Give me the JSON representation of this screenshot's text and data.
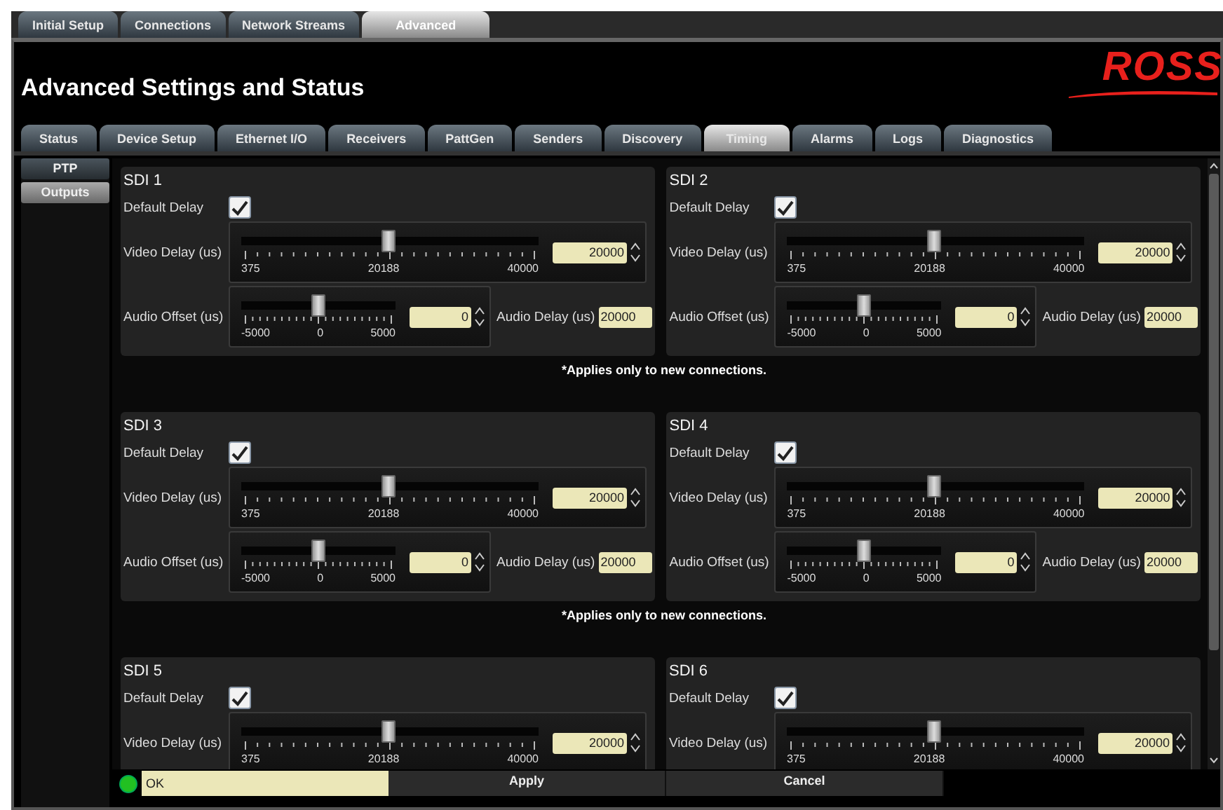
{
  "top_tabs": [
    {
      "label": "Initial Setup",
      "selected": false
    },
    {
      "label": "Connections",
      "selected": false
    },
    {
      "label": "Network Streams",
      "selected": false
    },
    {
      "label": "Advanced",
      "selected": true
    }
  ],
  "header": {
    "title": "Advanced Settings and Status",
    "logo": "ROSS"
  },
  "sub_tabs": [
    {
      "label": "Status",
      "selected": false
    },
    {
      "label": "Device Setup",
      "selected": false
    },
    {
      "label": "Ethernet I/O",
      "selected": false
    },
    {
      "label": "Receivers",
      "selected": false
    },
    {
      "label": "PattGen",
      "selected": false
    },
    {
      "label": "Senders",
      "selected": false
    },
    {
      "label": "Discovery",
      "selected": false
    },
    {
      "label": "Timing",
      "selected": true
    },
    {
      "label": "Alarms",
      "selected": false
    },
    {
      "label": "Logs",
      "selected": false
    },
    {
      "label": "Diagnostics",
      "selected": false
    }
  ],
  "side_menu": [
    {
      "label": "PTP",
      "selected": false
    },
    {
      "label": "Outputs",
      "selected": true
    }
  ],
  "groups": [
    {
      "channels": [
        {
          "name": "SDI 1",
          "default_delay": {
            "label": "Default Delay",
            "checked": true
          },
          "video_delay": {
            "label": "Video Delay (us)",
            "level": 0.495,
            "value": "20000",
            "ticks": [
              "375",
              "20188",
              "40000"
            ]
          },
          "audio_offset": {
            "label": "Audio Offset (us)",
            "level": 0.5,
            "value": "0",
            "ticks": [
              "-5000",
              "0",
              "5000"
            ]
          },
          "audio_delay": {
            "label": "Audio Delay (us)",
            "value": "20000"
          }
        },
        {
          "name": "SDI 2",
          "default_delay": {
            "label": "Default Delay",
            "checked": true
          },
          "video_delay": {
            "label": "Video Delay (us)",
            "level": 0.495,
            "value": "20000",
            "ticks": [
              "375",
              "20188",
              "40000"
            ]
          },
          "audio_offset": {
            "label": "Audio Offset (us)",
            "level": 0.5,
            "value": "0",
            "ticks": [
              "-5000",
              "0",
              "5000"
            ]
          },
          "audio_delay": {
            "label": "Audio Delay (us)",
            "value": "20000"
          }
        }
      ],
      "note": "*Applies only to new connections."
    },
    {
      "channels": [
        {
          "name": "SDI 3",
          "default_delay": {
            "label": "Default Delay",
            "checked": true
          },
          "video_delay": {
            "label": "Video Delay (us)",
            "level": 0.495,
            "value": "20000",
            "ticks": [
              "375",
              "20188",
              "40000"
            ]
          },
          "audio_offset": {
            "label": "Audio Offset (us)",
            "level": 0.5,
            "value": "0",
            "ticks": [
              "-5000",
              "0",
              "5000"
            ]
          },
          "audio_delay": {
            "label": "Audio Delay (us)",
            "value": "20000"
          }
        },
        {
          "name": "SDI 4",
          "default_delay": {
            "label": "Default Delay",
            "checked": true
          },
          "video_delay": {
            "label": "Video Delay (us)",
            "level": 0.495,
            "value": "20000",
            "ticks": [
              "375",
              "20188",
              "40000"
            ]
          },
          "audio_offset": {
            "label": "Audio Offset (us)",
            "level": 0.5,
            "value": "0",
            "ticks": [
              "-5000",
              "0",
              "5000"
            ]
          },
          "audio_delay": {
            "label": "Audio Delay (us)",
            "value": "20000"
          }
        }
      ],
      "note": "*Applies only to new connections."
    },
    {
      "channels": [
        {
          "name": "SDI 5",
          "default_delay": {
            "label": "Default Delay",
            "checked": true
          },
          "video_delay": {
            "label": "Video Delay (us)",
            "level": 0.495,
            "value": "20000",
            "ticks": [
              "375",
              "20188",
              "40000"
            ]
          }
        },
        {
          "name": "SDI 6",
          "default_delay": {
            "label": "Default Delay",
            "checked": true
          },
          "video_delay": {
            "label": "Video Delay (us)",
            "level": 0.495,
            "value": "20000",
            "ticks": [
              "375",
              "20188",
              "40000"
            ]
          }
        }
      ]
    }
  ],
  "status": {
    "led_on": true,
    "message": "OK"
  },
  "buttons": [
    "Apply",
    "Cancel"
  ]
}
